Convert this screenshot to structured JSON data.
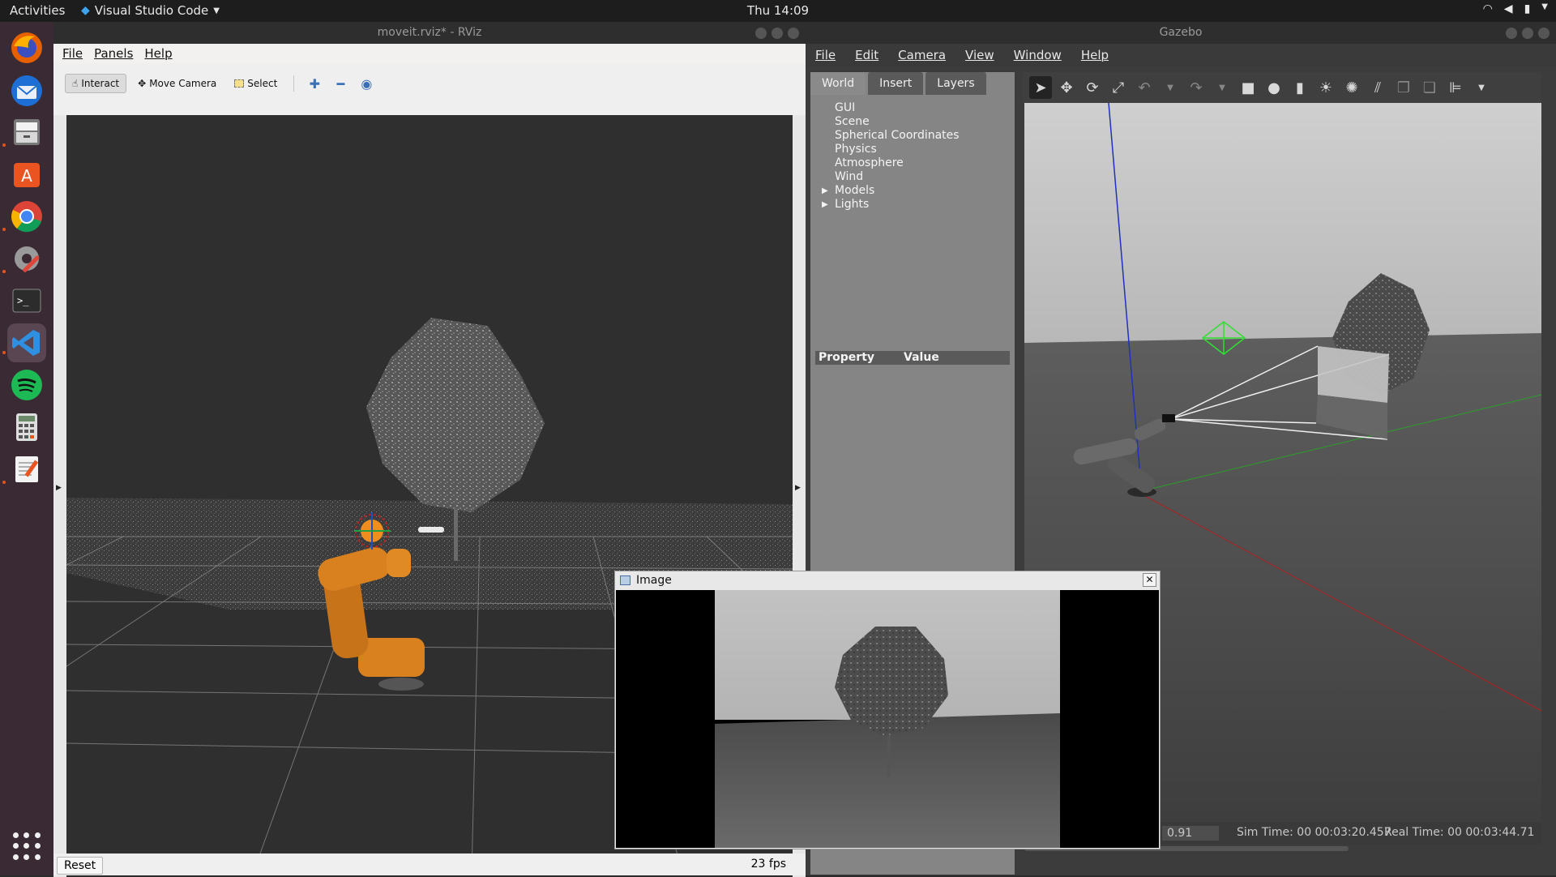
{
  "topbar": {
    "activities": "Activities",
    "app_name": "Visual Studio Code",
    "clock": "Thu 14:09"
  },
  "dock": {
    "items": [
      "firefox-icon",
      "thunderbird-icon",
      "files-icon",
      "software-icon",
      "chrome-icon",
      "settings-icon",
      "terminal-icon",
      "vscode-icon",
      "spotify-icon",
      "calculator-icon",
      "text-editor-icon"
    ]
  },
  "rviz": {
    "title": "moveit.rviz* - RViz",
    "menu": [
      "File",
      "Panels",
      "Help"
    ],
    "toolbar": {
      "interact": "Interact",
      "move_camera": "Move Camera",
      "select": "Select"
    },
    "reset": "Reset",
    "fps": "23 fps"
  },
  "gazebo": {
    "title": "Gazebo",
    "menu": [
      "File",
      "Edit",
      "Camera",
      "View",
      "Window",
      "Help"
    ],
    "tabs": [
      "World",
      "Insert",
      "Layers"
    ],
    "tree": [
      "GUI",
      "Scene",
      "Spherical Coordinates",
      "Physics",
      "Atmosphere",
      "Wind",
      "Models",
      "Lights"
    ],
    "property_header": "Property",
    "value_header": "Value",
    "rtf": "0.91",
    "sim_time_label": "Sim Time:",
    "sim_time": "00 00:03:20.457",
    "real_time_label": "Real Time:",
    "real_time": "00 00:03:44.71"
  },
  "image_window": {
    "title": "Image"
  },
  "colors": {
    "dock_bg": "#3a2a33",
    "ubuntu_orange": "#e95420",
    "robot_orange": "#d9801f"
  }
}
